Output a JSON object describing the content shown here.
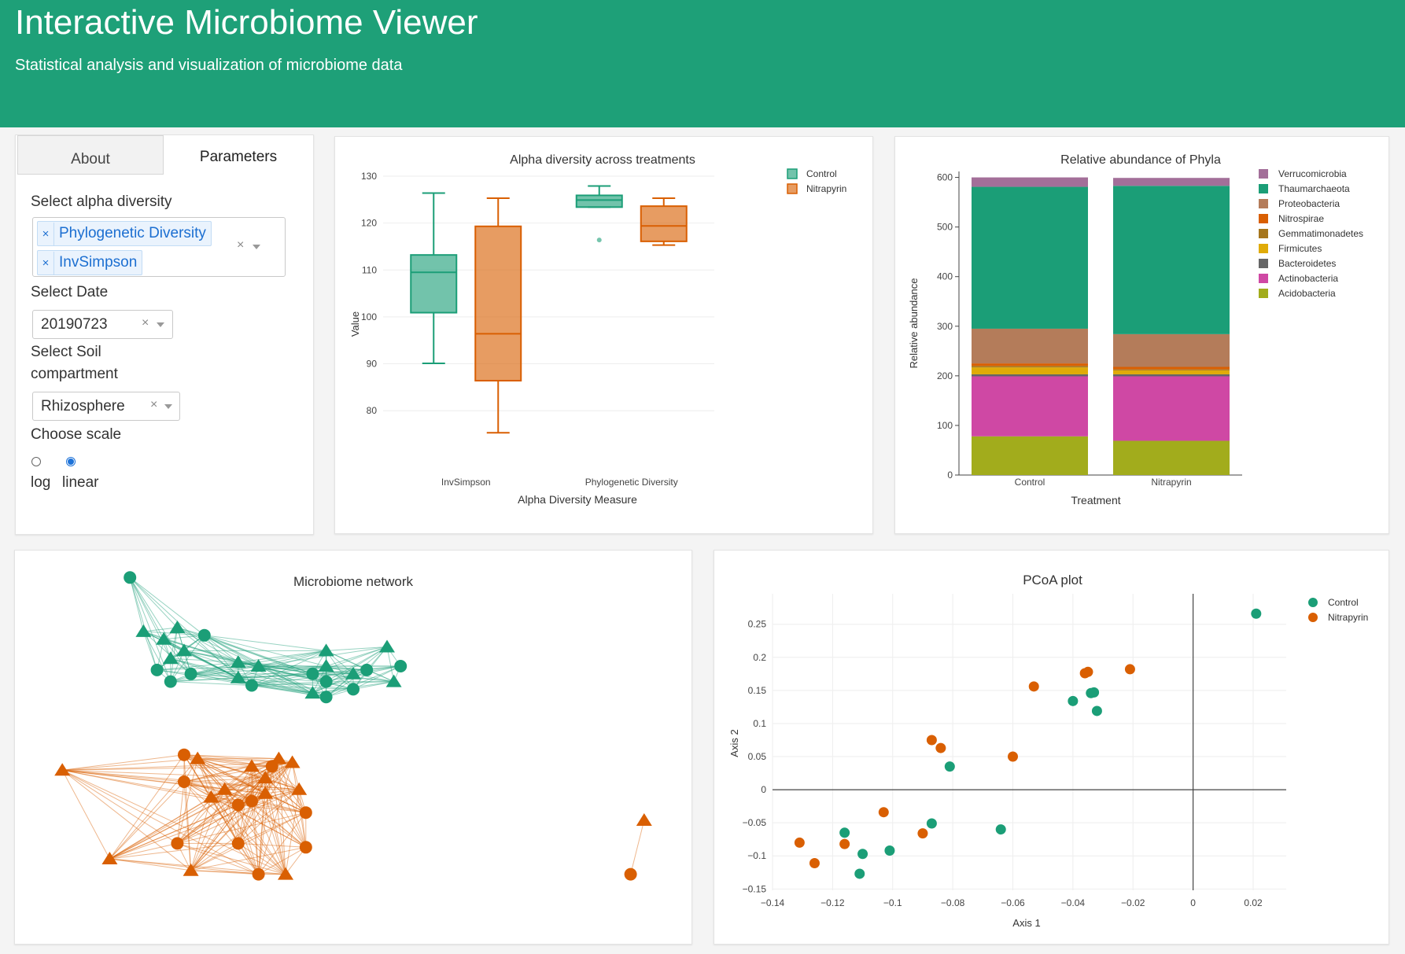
{
  "header": {
    "title": "Interactive Microbiome Viewer",
    "subtitle": "Statistical analysis and visualization of microbiome data"
  },
  "sidebar": {
    "tabs": [
      {
        "label": "About",
        "active": false
      },
      {
        "label": "Parameters",
        "active": true
      }
    ],
    "alpha_label": "Select alpha diversity",
    "alpha_selected": [
      "Phylogenetic Diversity",
      "InvSimpson"
    ],
    "date_label": "Select Date",
    "date_value": "20190723",
    "soil_label_1": "Select Soil",
    "soil_label_2": "compartment",
    "soil_value": "Rhizosphere",
    "scale_label": "Choose scale",
    "scale_options": [
      "log",
      "linear"
    ],
    "scale_selected": "linear",
    "chip_remove": "×",
    "clear_glyph": "×"
  },
  "colors": {
    "control": "#1b9e77",
    "nitrapyrin": "#d95f02",
    "header": "#1ea078"
  },
  "chart_data": [
    {
      "type": "box",
      "title": "Alpha diversity across treatments",
      "xlabel": "Alpha Diversity Measure",
      "ylabel": "Value",
      "categories": [
        "InvSimpson",
        "Phylogenetic Diversity"
      ],
      "yticks": [
        80,
        90,
        100,
        110,
        120,
        130
      ],
      "ylim": [
        74,
        131
      ],
      "legend": [
        "Control",
        "Nitrapyrin"
      ],
      "series": [
        {
          "name": "Control",
          "boxes": [
            {
              "min": 90.1,
              "q1": 100.9,
              "median": 109.5,
              "q3": 113.2,
              "max": 126.4,
              "outliers": []
            },
            {
              "min": 123.4,
              "q1": 123.4,
              "median": 124.9,
              "q3": 125.9,
              "max": 127.9,
              "outliers": [
                116.4
              ]
            }
          ]
        },
        {
          "name": "Nitrapyrin",
          "boxes": [
            {
              "min": 75.3,
              "q1": 86.4,
              "median": 96.4,
              "q3": 119.3,
              "max": 125.3,
              "outliers": []
            },
            {
              "min": 115.3,
              "q1": 116.1,
              "median": 119.4,
              "q3": 123.6,
              "max": 125.3,
              "outliers": []
            }
          ]
        }
      ]
    },
    {
      "type": "bar",
      "stacked": true,
      "title": "Relative abundance of Phyla",
      "xlabel": "Treatment",
      "ylabel": "Relative abundance",
      "categories": [
        "Control",
        "Nitrapyrin"
      ],
      "yticks": [
        0,
        100,
        200,
        300,
        400,
        500,
        600
      ],
      "ylim": [
        0,
        612
      ],
      "series": [
        {
          "name": "Acidobacteria",
          "color": "#a2ac1c",
          "values": [
            78,
            69
          ]
        },
        {
          "name": "Actinobacteria",
          "color": "#cf48a4",
          "values": [
            121,
            130
          ]
        },
        {
          "name": "Bacteroidetes",
          "color": "#666666",
          "values": [
            4,
            4
          ]
        },
        {
          "name": "Firmicutes",
          "color": "#e0ab08",
          "values": [
            14,
            8
          ]
        },
        {
          "name": "Gemmatimonadetes",
          "color": "#a6761d",
          "values": [
            3,
            2
          ]
        },
        {
          "name": "Nitrospirae",
          "color": "#d95f02",
          "values": [
            5,
            5
          ]
        },
        {
          "name": "Proteobacteria",
          "color": "#b47c5a",
          "values": [
            70,
            66
          ]
        },
        {
          "name": "Thaumarchaeota",
          "color": "#1b9e77",
          "values": [
            286,
            299
          ]
        },
        {
          "name": "Verrucomicrobia",
          "color": "#a36f99",
          "values": [
            19,
            16
          ]
        }
      ]
    },
    {
      "type": "network",
      "title": "Microbiome network",
      "groups": [
        {
          "name": "Control",
          "color": "#1b9e77",
          "nodes": [
            {
              "x": 0.17,
              "y": 0.93,
              "s": "circle"
            },
            {
              "x": 0.19,
              "y": 0.79,
              "s": "triangle"
            },
            {
              "x": 0.24,
              "y": 0.8,
              "s": "triangle"
            },
            {
              "x": 0.28,
              "y": 0.78,
              "s": "circle"
            },
            {
              "x": 0.22,
              "y": 0.77,
              "s": "triangle"
            },
            {
              "x": 0.25,
              "y": 0.74,
              "s": "triangle"
            },
            {
              "x": 0.23,
              "y": 0.72,
              "s": "triangle"
            },
            {
              "x": 0.21,
              "y": 0.69,
              "s": "circle"
            },
            {
              "x": 0.26,
              "y": 0.68,
              "s": "circle"
            },
            {
              "x": 0.23,
              "y": 0.66,
              "s": "circle"
            },
            {
              "x": 0.33,
              "y": 0.71,
              "s": "triangle"
            },
            {
              "x": 0.36,
              "y": 0.7,
              "s": "triangle"
            },
            {
              "x": 0.33,
              "y": 0.67,
              "s": "triangle"
            },
            {
              "x": 0.35,
              "y": 0.65,
              "s": "circle"
            },
            {
              "x": 0.46,
              "y": 0.74,
              "s": "triangle"
            },
            {
              "x": 0.46,
              "y": 0.7,
              "s": "triangle"
            },
            {
              "x": 0.44,
              "y": 0.68,
              "s": "circle"
            },
            {
              "x": 0.46,
              "y": 0.66,
              "s": "circle"
            },
            {
              "x": 0.5,
              "y": 0.68,
              "s": "triangle"
            },
            {
              "x": 0.44,
              "y": 0.63,
              "s": "triangle"
            },
            {
              "x": 0.46,
              "y": 0.62,
              "s": "circle"
            },
            {
              "x": 0.5,
              "y": 0.64,
              "s": "circle"
            },
            {
              "x": 0.52,
              "y": 0.69,
              "s": "circle"
            },
            {
              "x": 0.55,
              "y": 0.75,
              "s": "triangle"
            },
            {
              "x": 0.57,
              "y": 0.7,
              "s": "circle"
            },
            {
              "x": 0.56,
              "y": 0.66,
              "s": "triangle"
            }
          ]
        },
        {
          "name": "Nitrapyrin",
          "color": "#d95f02",
          "nodes": [
            {
              "x": 0.07,
              "y": 0.43,
              "s": "triangle"
            },
            {
              "x": 0.14,
              "y": 0.2,
              "s": "triangle"
            },
            {
              "x": 0.25,
              "y": 0.47,
              "s": "circle"
            },
            {
              "x": 0.27,
              "y": 0.46,
              "s": "triangle"
            },
            {
              "x": 0.25,
              "y": 0.4,
              "s": "circle"
            },
            {
              "x": 0.29,
              "y": 0.36,
              "s": "triangle"
            },
            {
              "x": 0.31,
              "y": 0.38,
              "s": "triangle"
            },
            {
              "x": 0.35,
              "y": 0.44,
              "s": "triangle"
            },
            {
              "x": 0.37,
              "y": 0.41,
              "s": "triangle"
            },
            {
              "x": 0.38,
              "y": 0.44,
              "s": "circle"
            },
            {
              "x": 0.39,
              "y": 0.46,
              "s": "triangle"
            },
            {
              "x": 0.41,
              "y": 0.45,
              "s": "triangle"
            },
            {
              "x": 0.33,
              "y": 0.34,
              "s": "circle"
            },
            {
              "x": 0.35,
              "y": 0.35,
              "s": "circle"
            },
            {
              "x": 0.37,
              "y": 0.37,
              "s": "triangle"
            },
            {
              "x": 0.42,
              "y": 0.38,
              "s": "triangle"
            },
            {
              "x": 0.43,
              "y": 0.32,
              "s": "circle"
            },
            {
              "x": 0.24,
              "y": 0.24,
              "s": "circle"
            },
            {
              "x": 0.26,
              "y": 0.17,
              "s": "triangle"
            },
            {
              "x": 0.33,
              "y": 0.24,
              "s": "circle"
            },
            {
              "x": 0.36,
              "y": 0.16,
              "s": "circle"
            },
            {
              "x": 0.4,
              "y": 0.16,
              "s": "triangle"
            },
            {
              "x": 0.43,
              "y": 0.23,
              "s": "circle"
            },
            {
              "x": 0.93,
              "y": 0.3,
              "s": "triangle"
            },
            {
              "x": 0.91,
              "y": 0.16,
              "s": "circle"
            }
          ]
        }
      ]
    },
    {
      "type": "scatter",
      "title": "PCoA plot",
      "xlabel": "Axis 1",
      "ylabel": "Axis 2",
      "xlim": [
        -0.14,
        0.031
      ],
      "ylim": [
        -0.152,
        0.296
      ],
      "xticks": [
        -0.14,
        -0.12,
        -0.1,
        -0.08,
        -0.06,
        -0.04,
        -0.02,
        0,
        0.02
      ],
      "xtick_labels": [
        "−0.14",
        "−0.12",
        "−0.1",
        "−0.08",
        "−0.06",
        "−0.04",
        "−0.02",
        "0",
        "0.02"
      ],
      "yticks": [
        -0.15,
        -0.1,
        -0.05,
        0,
        0.05,
        0.1,
        0.15,
        0.2,
        0.25
      ],
      "ytick_labels": [
        "−0.15",
        "−0.1",
        "−0.05",
        "0",
        "0.05",
        "0.1",
        "0.15",
        "0.2",
        "0.25"
      ],
      "series": [
        {
          "name": "Control",
          "color": "#1b9e77",
          "points": [
            [
              0.021,
              0.266
            ],
            [
              -0.04,
              0.134
            ],
            [
              -0.034,
              0.146
            ],
            [
              -0.033,
              0.147
            ],
            [
              -0.032,
              0.119
            ],
            [
              -0.081,
              0.035
            ],
            [
              -0.064,
              -0.06
            ],
            [
              -0.087,
              -0.051
            ],
            [
              -0.101,
              -0.092
            ],
            [
              -0.11,
              -0.097
            ],
            [
              -0.116,
              -0.065
            ],
            [
              -0.111,
              -0.127
            ]
          ]
        },
        {
          "name": "Nitrapyrin",
          "color": "#d95f02",
          "points": [
            [
              -0.021,
              0.182
            ],
            [
              -0.035,
              0.178
            ],
            [
              -0.036,
              0.176
            ],
            [
              -0.053,
              0.156
            ],
            [
              -0.087,
              0.075
            ],
            [
              -0.084,
              0.063
            ],
            [
              -0.06,
              0.05
            ],
            [
              -0.103,
              -0.034
            ],
            [
              -0.09,
              -0.066
            ],
            [
              -0.116,
              -0.082
            ],
            [
              -0.131,
              -0.08
            ],
            [
              -0.126,
              -0.111
            ]
          ]
        }
      ]
    }
  ]
}
